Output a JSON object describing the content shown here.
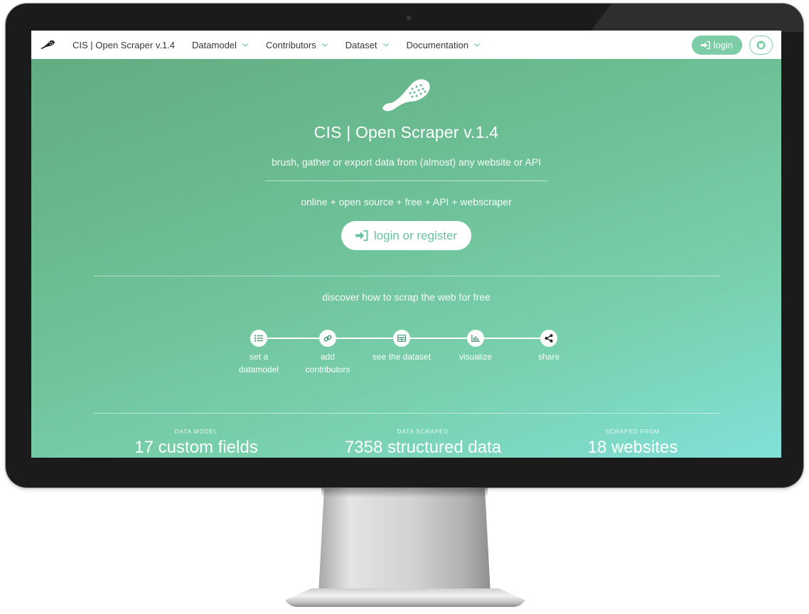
{
  "navbar": {
    "brand_title": "CIS | Open Scraper v.1.4",
    "menu": [
      {
        "label": "Datamodel"
      },
      {
        "label": "Contributors"
      },
      {
        "label": "Dataset"
      },
      {
        "label": "Documentation"
      }
    ],
    "login_label": "login",
    "github_icon": "github-icon"
  },
  "hero": {
    "title": "CIS | Open Scraper v.1.4",
    "subtitle": "brush, gather or export data from (almost) any website or API",
    "tagline": "online + open source + free + API + webscraper",
    "cta_label": "login or register",
    "discover": "discover how to scrap the web for free"
  },
  "steps": [
    {
      "icon": "list-icon",
      "label_line1": "set a",
      "label_line2": "datamodel"
    },
    {
      "icon": "link-icon",
      "label_line1": "add",
      "label_line2": "contributors"
    },
    {
      "icon": "table-icon",
      "label_line1": "see the dataset",
      "label_line2": ""
    },
    {
      "icon": "bar-chart-icon",
      "label_line1": "visualize",
      "label_line2": ""
    },
    {
      "icon": "share-icon",
      "label_line1": "share",
      "label_line2": ""
    }
  ],
  "stats": [
    {
      "label": "DATA MODEL",
      "value": "17 custom fields"
    },
    {
      "label": "DATA SCRAPED",
      "value": "7358 structured data"
    },
    {
      "label": "SCRAPED FROM",
      "value": "18 websites"
    }
  ],
  "colors": {
    "accent": "#7ccca6",
    "hero_start": "#63ac82",
    "hero_end": "#82e0d8",
    "navbar_bg": "#ffffff",
    "monitor_bezel": "#1b1b1b"
  }
}
